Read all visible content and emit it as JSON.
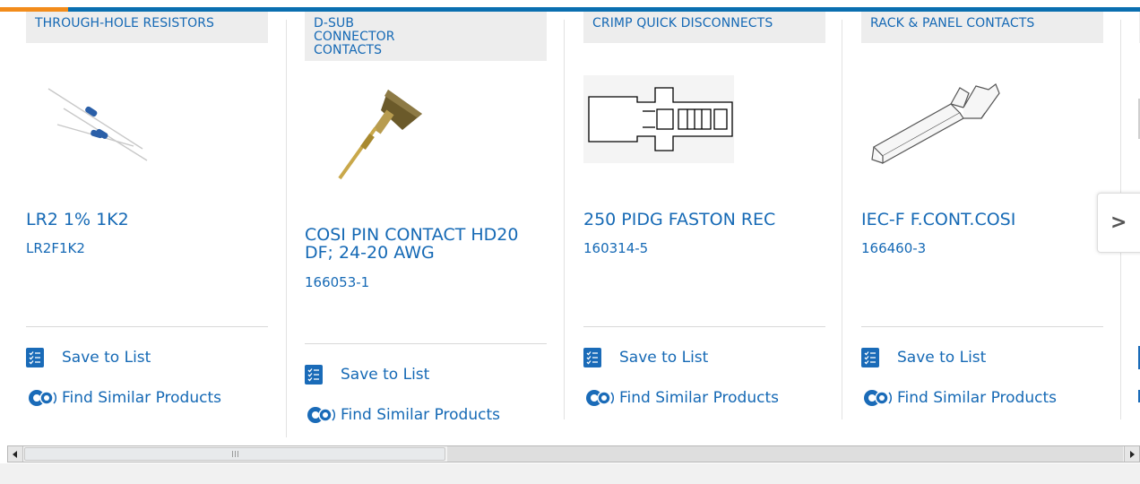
{
  "colors": {
    "brand_blue": "#1569b5",
    "accent_orange": "#f28c1b",
    "category_bg": "#ededed"
  },
  "cards": [
    {
      "category": "THROUGH-HOLE RESISTORS",
      "title": "LR2 1% 1K2",
      "part_number": "LR2F1K2",
      "image_icon": "resistor-image"
    },
    {
      "category": "D-SUB CONNECTOR CONTACTS",
      "title": "COSI PIN CONTACT HD20 DF; 24-20 AWG",
      "part_number": "166053-1",
      "image_icon": "pin-contact-image"
    },
    {
      "category": "CRIMP QUICK DISCONNECTS",
      "title": "250 PIDG FASTON REC",
      "part_number": "160314-5",
      "image_icon": "faston-receptacle-image"
    },
    {
      "category": "RACK & PANEL CONTACTS",
      "title": "IEC-F F.CONT.COSI",
      "part_number": "166460-3",
      "image_icon": "rack-panel-contact-image"
    }
  ],
  "actions": {
    "save_label": "Save to List",
    "similar_label": "Find Similar Products"
  },
  "carousel": {
    "next_label": ">"
  }
}
